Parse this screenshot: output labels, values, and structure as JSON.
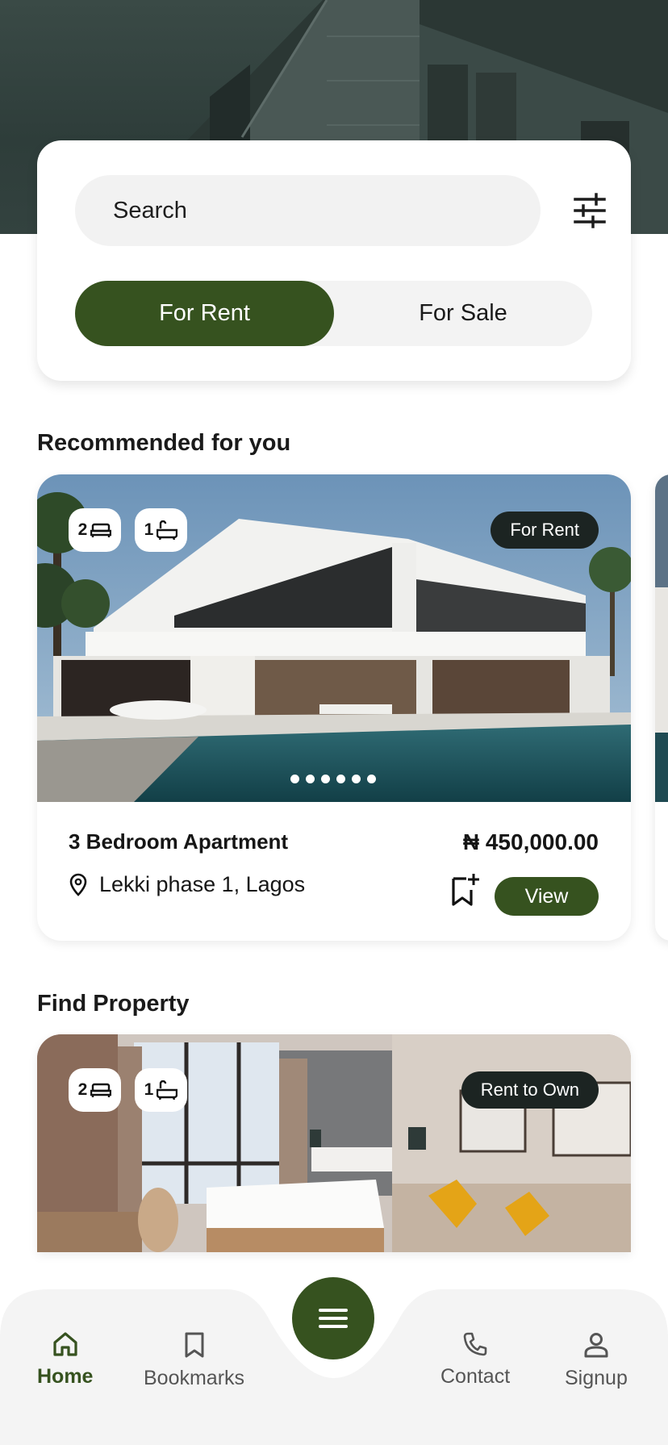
{
  "search": {
    "placeholder": "Search"
  },
  "filter": {
    "icon": "sliders-icon"
  },
  "toggle": {
    "rent_label": "For Rent",
    "sale_label": "For Sale"
  },
  "sections": {
    "recommended": "Recommended for you",
    "find": "Find Property"
  },
  "recommended": {
    "bedrooms": "2",
    "bathrooms": "1",
    "tag": "For Rent",
    "title": "3 Bedroom Apartment",
    "price": "₦ 450,000.00",
    "location": "Lekki phase 1, Lagos",
    "view_label": "View",
    "slide_count": 6
  },
  "find_property": {
    "bedrooms": "2",
    "bathrooms": "1",
    "tag": "Rent to Own"
  },
  "nav": {
    "home": "Home",
    "bookmarks": "Bookmarks",
    "contact": "Contact",
    "signup": "Signup"
  },
  "colors": {
    "accent": "#36521f",
    "tag_bg": "#1c2422",
    "hero_bg": "#33423f"
  }
}
